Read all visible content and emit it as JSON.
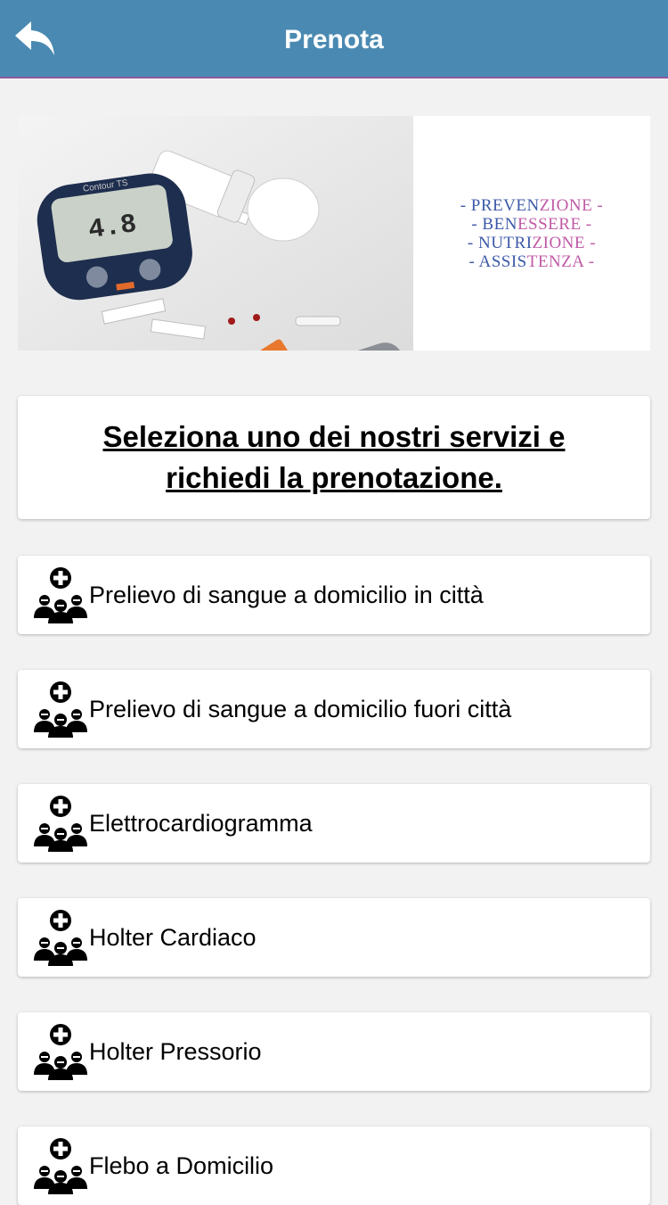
{
  "header": {
    "title": "Prenota",
    "back_icon": "back-arrow-icon",
    "bg_color": "#4a8ab2"
  },
  "banner": {
    "slogan": [
      {
        "a": "- PREVEN",
        "b": "ZIONE -"
      },
      {
        "a": "- BEN",
        "b": "ESSERE -"
      },
      {
        "a": "- NUTRI",
        "b": "ZIONE -"
      },
      {
        "a": "- ASSIS",
        "b": "TENZA -"
      }
    ],
    "meter_display": "4.8",
    "meter_brand": "Contour TS"
  },
  "intro": {
    "text": "Seleziona uno dei nostri servizi e richiedi la prenotazione."
  },
  "services": [
    {
      "label": "Prelievo di sangue a domicilio in città",
      "icon": "medical-team-icon"
    },
    {
      "label": "Prelievo di sangue a domicilio fuori città",
      "icon": "medical-team-icon"
    },
    {
      "label": "Elettrocardiogramma",
      "icon": "medical-team-icon"
    },
    {
      "label": "Holter Cardiaco",
      "icon": "medical-team-icon"
    },
    {
      "label": "Holter Pressorio",
      "icon": "medical-team-icon"
    },
    {
      "label": "Flebo a Domicilio",
      "icon": "medical-team-icon"
    }
  ]
}
